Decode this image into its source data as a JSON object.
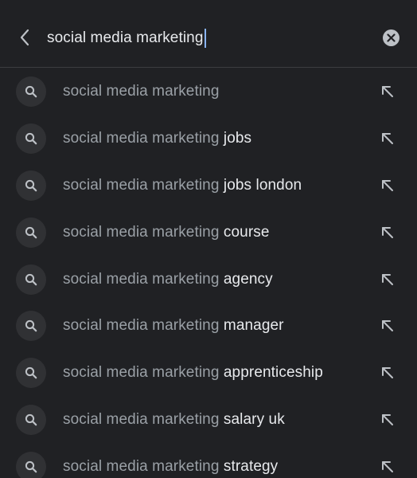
{
  "search": {
    "query": "social media marketing"
  },
  "icons": {
    "back": "chevron-left-icon",
    "clear": "clear-circle-icon",
    "suggestion": "search-icon",
    "fill": "arrow-up-left-icon"
  },
  "colors": {
    "background": "#202124",
    "prefix_text": "#9aa0a6",
    "completion_text": "#e8eaed",
    "caret": "#8ab4f8"
  },
  "suggestions": [
    {
      "prefix": "social media marketing",
      "completion": ""
    },
    {
      "prefix": "social media marketing",
      "completion": " jobs"
    },
    {
      "prefix": "social media marketing",
      "completion": " jobs london"
    },
    {
      "prefix": "social media marketing",
      "completion": " course"
    },
    {
      "prefix": "social media marketing",
      "completion": " agency"
    },
    {
      "prefix": "social media marketing",
      "completion": " manager"
    },
    {
      "prefix": "social media marketing",
      "completion": " apprenticeship"
    },
    {
      "prefix": "social media marketing",
      "completion": " salary uk"
    },
    {
      "prefix": "social media marketing",
      "completion": " strategy"
    }
  ]
}
